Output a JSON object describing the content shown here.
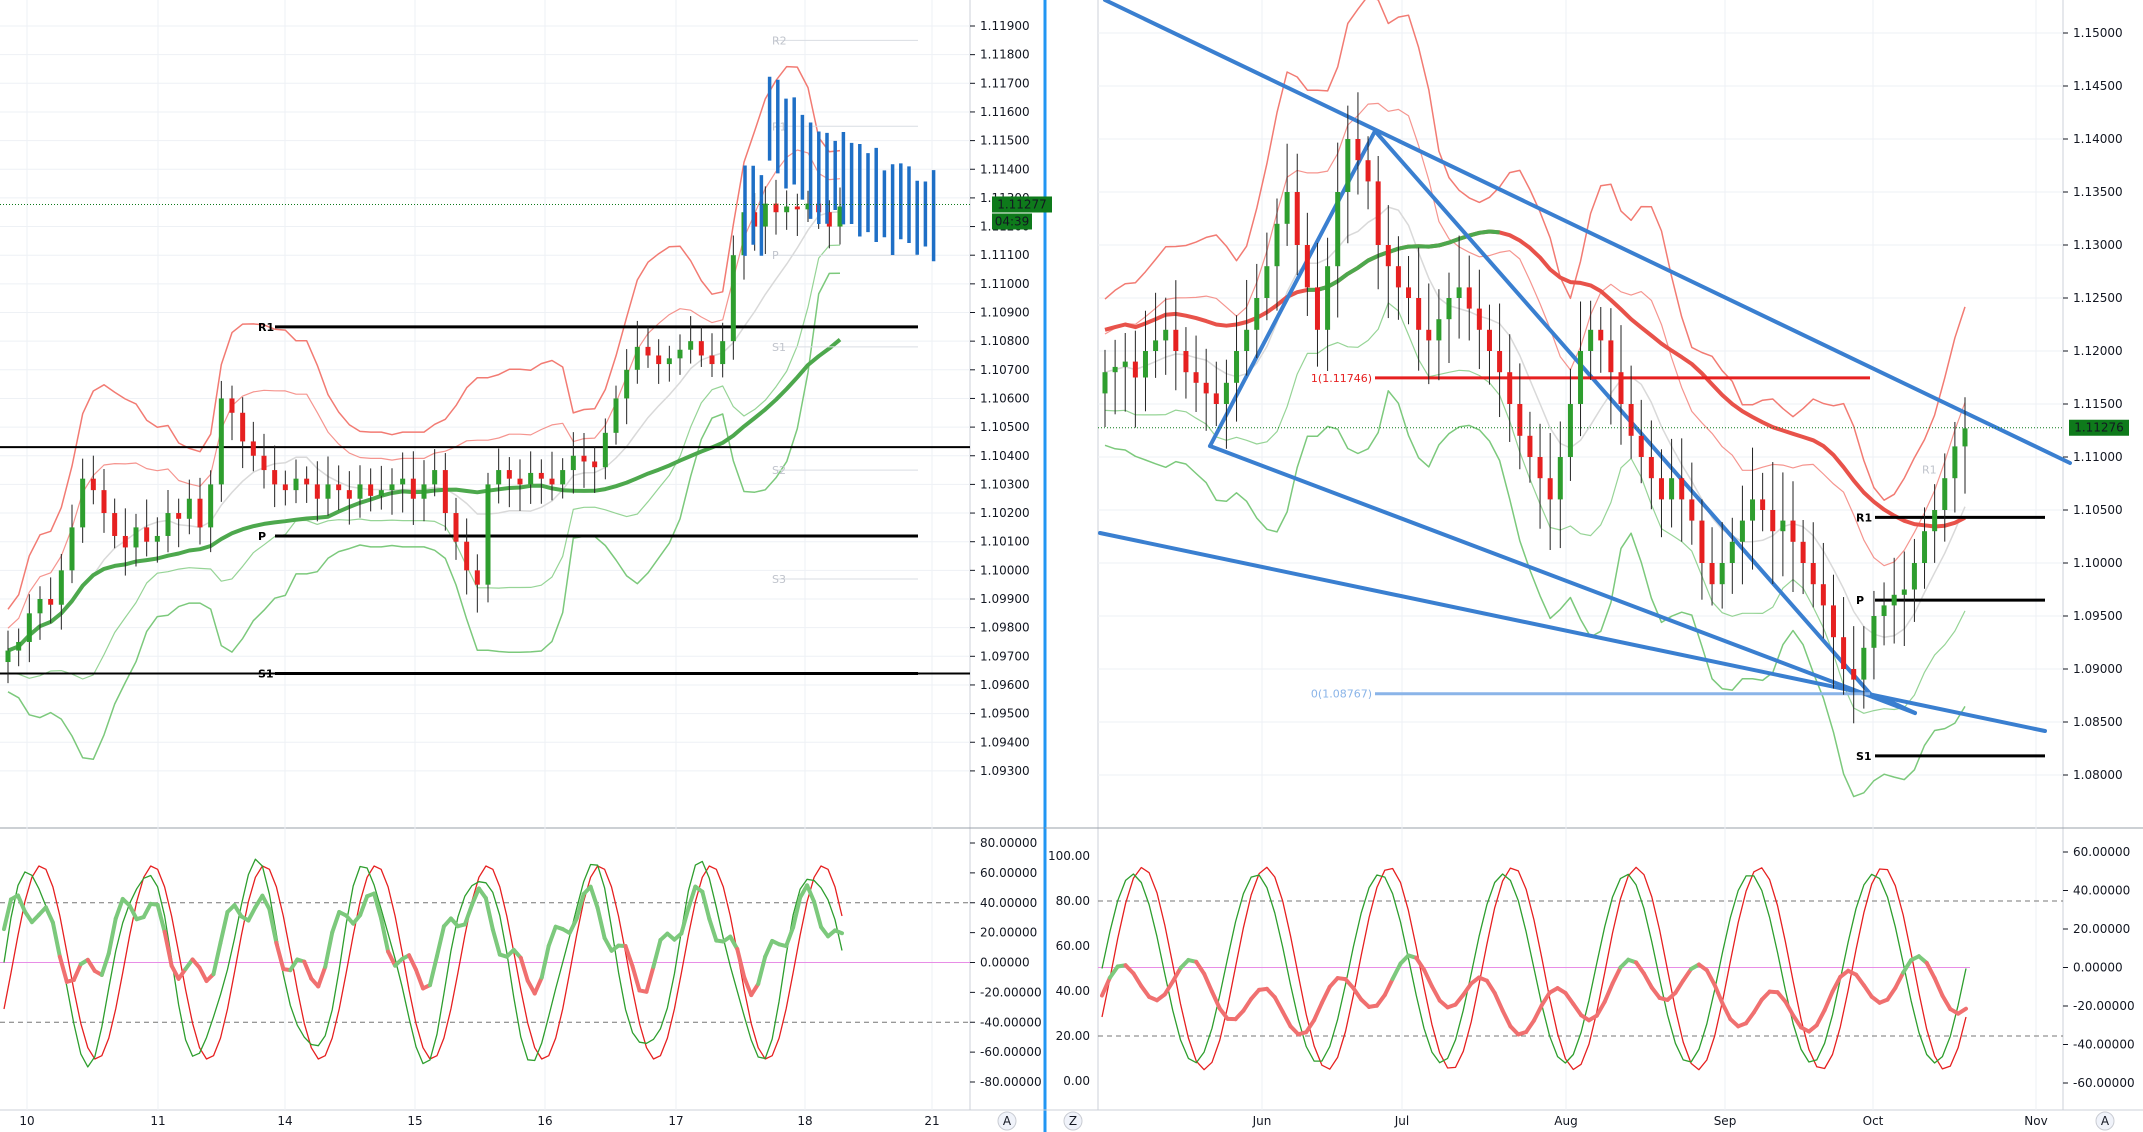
{
  "chart_data": [
    {
      "type": "candlestick",
      "panel": "left",
      "y_ticks": [
        "1.11900",
        "1.11800",
        "1.11700",
        "1.11600",
        "1.11500",
        "1.11400",
        "1.11300",
        "1.11200",
        "1.11100",
        "1.11000",
        "1.10900",
        "1.10800",
        "1.10700",
        "1.10600",
        "1.10500",
        "1.10400",
        "1.10300",
        "1.10200",
        "1.10100",
        "1.10000",
        "1.09900",
        "1.09800",
        "1.09700",
        "1.09600",
        "1.09500",
        "1.09400",
        "1.09300"
      ],
      "ylim": [
        1.0925,
        1.1195
      ],
      "x_ticks": [
        "10",
        "11",
        "14",
        "15",
        "16",
        "17",
        "18",
        "21"
      ],
      "price_badge": "1.11277",
      "countdown_badge": "04:39",
      "pivot_labels": {
        "R2": "R2",
        "R1_faint": "R1",
        "P_faint": "P",
        "S1_faint": "S1",
        "S2": "S2",
        "S3": "S3",
        "R1": "R1",
        "P": "P",
        "S1": "S1"
      },
      "levels": {
        "R1": 1.1085,
        "P": 1.1012,
        "S1": 1.0964,
        "black": 1.1043
      },
      "series_close": [
        1.0972,
        1.0975,
        1.0985,
        1.099,
        1.0988,
        1.1,
        1.1015,
        1.1032,
        1.1028,
        1.102,
        1.1012,
        1.1008,
        1.1015,
        1.101,
        1.1012,
        1.102,
        1.1018,
        1.1025,
        1.1015,
        1.103,
        1.106,
        1.1055,
        1.1045,
        1.104,
        1.1035,
        1.103,
        1.1028,
        1.1032,
        1.103,
        1.1025,
        1.103,
        1.1028,
        1.1025,
        1.103,
        1.1026,
        1.1028,
        1.103,
        1.1032,
        1.1025,
        1.103,
        1.1035,
        1.102,
        1.101,
        1.1,
        1.0995,
        1.103,
        1.1035,
        1.1032,
        1.103,
        1.1034,
        1.1032,
        1.103,
        1.1035,
        1.104,
        1.1038,
        1.1036,
        1.1048,
        1.106,
        1.107,
        1.1078,
        1.1075,
        1.1072,
        1.1074,
        1.1077,
        1.108,
        1.1075,
        1.1072,
        1.108,
        1.111,
        1.1125,
        1.112,
        1.1128,
        1.1125,
        1.1127,
        1.1126,
        1.1128,
        1.1125,
        1.112,
        1.1127
      ]
    },
    {
      "type": "candlestick",
      "panel": "right",
      "y_ticks": [
        "1.15000",
        "1.14500",
        "1.14000",
        "1.13500",
        "1.13000",
        "1.12500",
        "1.12000",
        "1.11500",
        "1.11000",
        "1.10500",
        "1.10000",
        "1.09500",
        "1.09000",
        "1.08500",
        "1.08000"
      ],
      "ylim": [
        1.0775,
        1.1525
      ],
      "x_ticks": [
        "Jun",
        "Jul",
        "Aug",
        "Sep",
        "Oct",
        "Nov"
      ],
      "price_badge": "1.11276",
      "fib_labels": {
        "top": "1(1.11746)",
        "bottom": "0(1.08767)"
      },
      "pivot_labels": {
        "R1": "R1",
        "P": "P",
        "S1": "S1",
        "R1_faint": "R1"
      },
      "levels": {
        "R1": 1.1043,
        "P": 1.0965,
        "S1": 1.0818
      },
      "series_close": [
        1.118,
        1.1185,
        1.119,
        1.1175,
        1.12,
        1.121,
        1.122,
        1.12,
        1.118,
        1.117,
        1.116,
        1.115,
        1.117,
        1.12,
        1.122,
        1.125,
        1.128,
        1.132,
        1.135,
        1.13,
        1.126,
        1.122,
        1.128,
        1.135,
        1.14,
        1.138,
        1.136,
        1.13,
        1.128,
        1.126,
        1.125,
        1.122,
        1.121,
        1.123,
        1.125,
        1.126,
        1.124,
        1.122,
        1.12,
        1.118,
        1.115,
        1.112,
        1.11,
        1.108,
        1.106,
        1.11,
        1.115,
        1.12,
        1.122,
        1.121,
        1.118,
        1.115,
        1.112,
        1.11,
        1.108,
        1.106,
        1.108,
        1.106,
        1.104,
        1.1,
        1.098,
        1.1,
        1.102,
        1.104,
        1.106,
        1.105,
        1.103,
        1.104,
        1.102,
        1.1,
        1.098,
        1.096,
        1.093,
        1.09,
        1.089,
        1.092,
        1.095,
        1.096,
        1.097,
        1.0975,
        1.1,
        1.103,
        1.105,
        1.108,
        1.111,
        1.1127
      ]
    },
    {
      "type": "line",
      "panel": "left-oscillator",
      "y_ticks": [
        "80.00000",
        "60.00000",
        "40.00000",
        "20.00000",
        "0.00000",
        "-20.00000",
        "-40.00000",
        "-60.00000",
        "-80.00000"
      ],
      "ylim": [
        -88,
        88
      ],
      "x_ticks": [
        "10",
        "11",
        "14",
        "15",
        "16",
        "17",
        "18",
        "21"
      ]
    },
    {
      "type": "line",
      "panel": "right-oscillator",
      "y_ticks_left": [
        "100.00",
        "80.00",
        "60.00",
        "40.00",
        "20.00",
        "0.00"
      ],
      "y_ticks_right": [
        "60.00000",
        "40.00000",
        "20.00000",
        "0.00000",
        "-20.00000",
        "-40.00000",
        "-60.00000"
      ],
      "x_ticks": [
        "Jun",
        "Jul",
        "Aug",
        "Sep",
        "Oct",
        "Nov"
      ]
    }
  ],
  "footer": {
    "left_scale_label": "A",
    "right_z_label": "Z",
    "right_scale_label": "A"
  },
  "colors": {
    "bull": "#2e9e2e",
    "bear": "#e62020",
    "tick_blue": "#1e6fc6",
    "trend": "#3a7fd0",
    "band_red": "#f27b73",
    "band_green": "#7cc97c",
    "ma_green": "#4da84d",
    "ma_red": "#e8524a",
    "badge": "#0e7a1b"
  }
}
